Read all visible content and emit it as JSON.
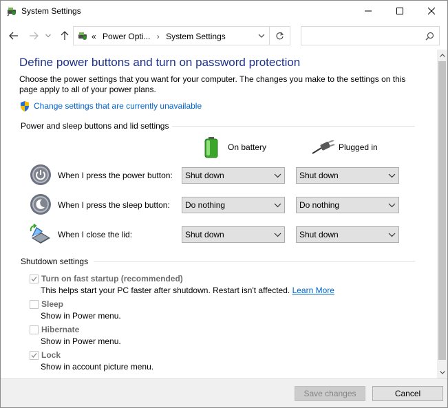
{
  "window": {
    "title": "System Settings"
  },
  "address": {
    "crumbs_prefix": "«",
    "crumb1": "Power Opti...",
    "crumb2": "System Settings",
    "search_placeholder": ""
  },
  "main": {
    "heading": "Define power buttons and turn on password protection",
    "description": "Choose the power settings that you want for your computer. The changes you make to the settings on this page apply to all of your power plans.",
    "change_link": "Change settings that are currently unavailable",
    "power_group": {
      "title": "Power and sleep buttons and lid settings",
      "col_battery": "On battery",
      "col_plugged": "Plugged in",
      "rows": [
        {
          "label": "When I press the power button:",
          "battery": "Shut down",
          "plugged": "Shut down"
        },
        {
          "label": "When I press the sleep button:",
          "battery": "Do nothing",
          "plugged": "Do nothing"
        },
        {
          "label": "When I close the lid:",
          "battery": "Shut down",
          "plugged": "Shut down"
        }
      ]
    },
    "shutdown_group": {
      "title": "Shutdown settings",
      "items": [
        {
          "label": "Turn on fast startup (recommended)",
          "checked": true,
          "desc": "This helps start your PC faster after shutdown. Restart isn't affected.",
          "link": "Learn More"
        },
        {
          "label": "Sleep",
          "checked": false,
          "desc": "Show in Power menu."
        },
        {
          "label": "Hibernate",
          "checked": false,
          "desc": "Show in Power menu."
        },
        {
          "label": "Lock",
          "checked": true,
          "desc": "Show in account picture menu."
        }
      ]
    }
  },
  "footer": {
    "save_label": "Save changes",
    "cancel_label": "Cancel"
  },
  "colors": {
    "heading": "#1e3287",
    "link": "#0066cc",
    "disabled_text": "#6d6d6d"
  }
}
